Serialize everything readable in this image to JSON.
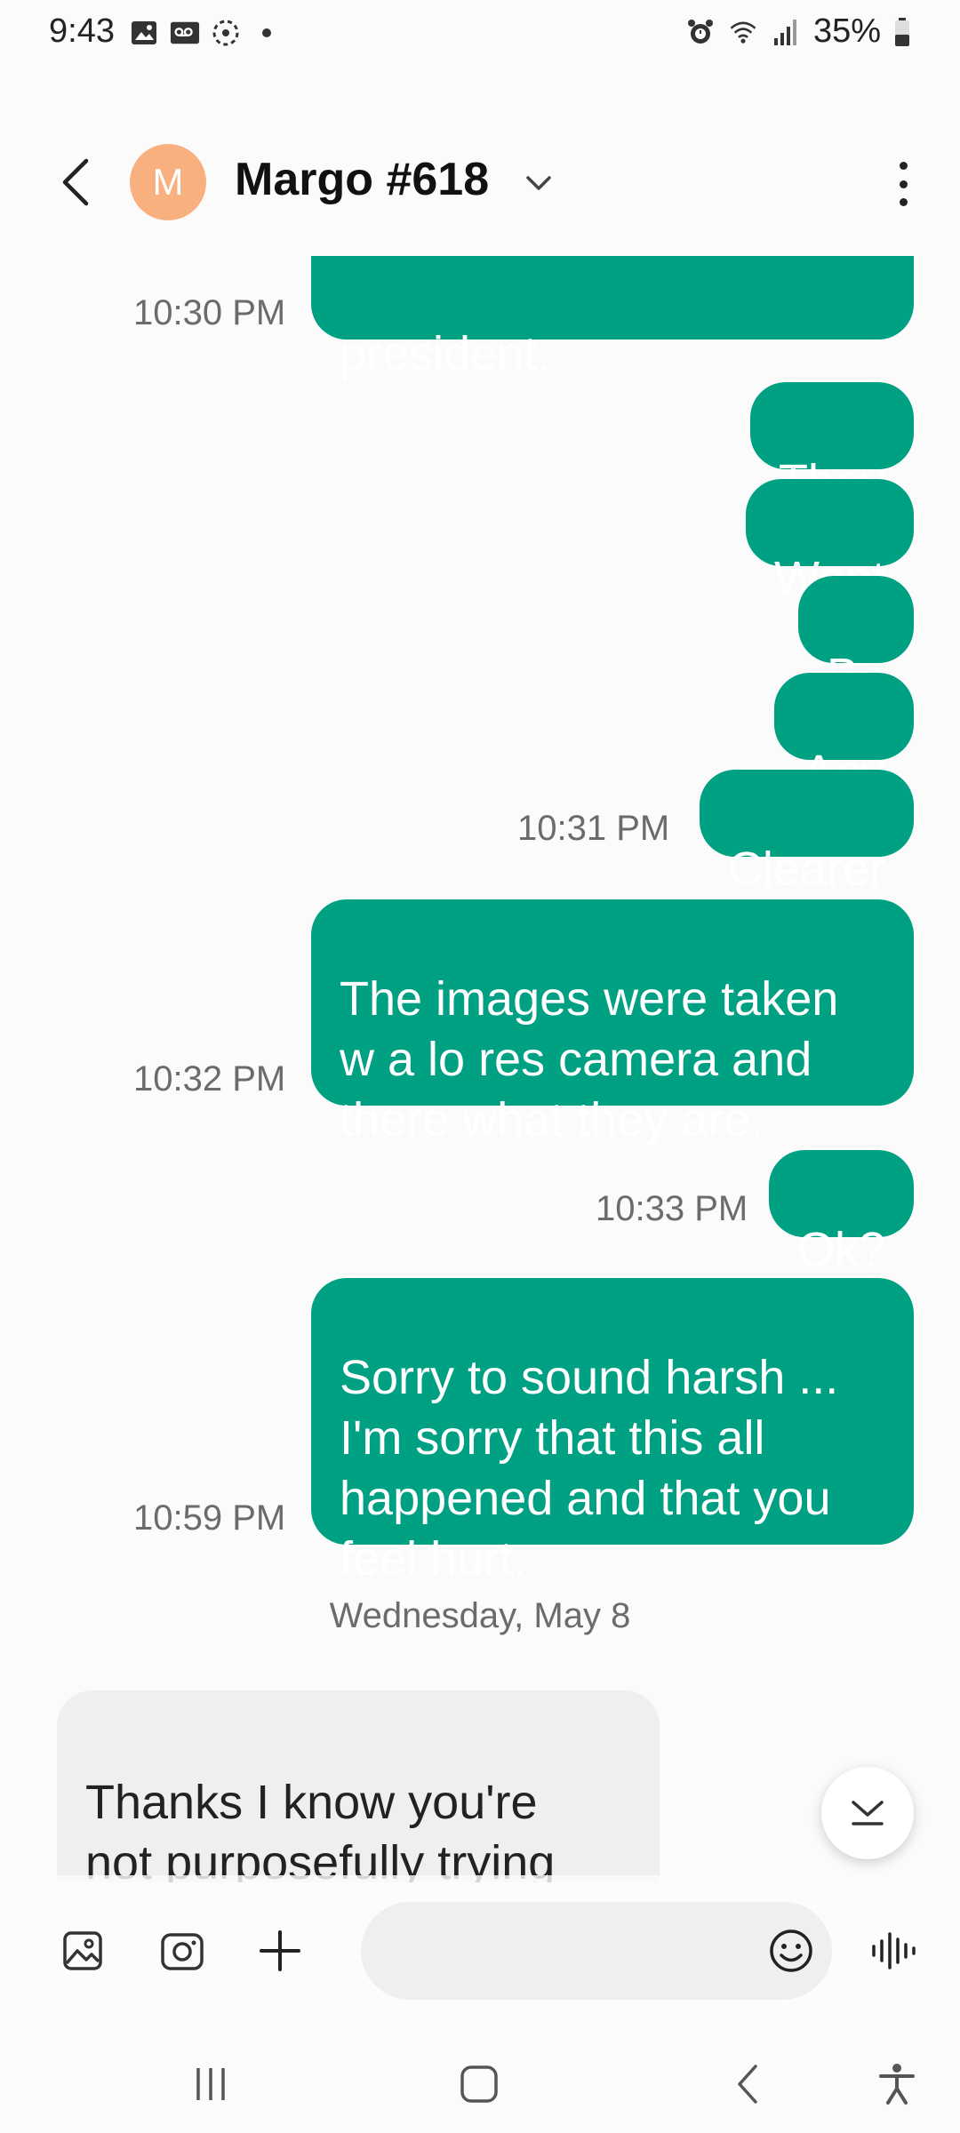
{
  "status_bar": {
    "time": "9:43",
    "battery": "35%",
    "left_icons": [
      "gallery-icon",
      "voicemail-icon",
      "sync-icon",
      "dot-icon"
    ],
    "right_icons": [
      "alarm-icon",
      "wifi-icon",
      "signal-icon",
      "battery-icon"
    ]
  },
  "header": {
    "avatar_initial": "M",
    "avatar_color": "#f9b07f",
    "contact_name": "Margo #618"
  },
  "messages": [
    {
      "text": "president.",
      "time": "10:30 PM"
    },
    {
      "text": "They"
    },
    {
      "text": "Wont"
    },
    {
      "text": "Be"
    },
    {
      "text": "Any"
    },
    {
      "text": "Clearer",
      "time": "10:31 PM"
    },
    {
      "text": "The images were taken\nw a lo res camera and\nthere what they are.",
      "time": "10:32 PM"
    },
    {
      "text": "Ok?",
      "time": "10:33 PM"
    },
    {
      "text": "Sorry to sound harsh ...\nI'm sorry that this all\nhappened and that you\nfeel hurt.",
      "time": "10:59 PM"
    }
  ],
  "date_separator": "Wednesday, May 8",
  "incoming_message": {
    "text": "Thanks I know you're\nnot purposefully trying\nto hurt me...I take heart\nin that! Truly\nI deciphered"
  },
  "composer": {
    "placeholder": "",
    "icons": [
      "gallery-icon",
      "camera-icon",
      "plus-icon",
      "emoji-icon",
      "voice-icon"
    ]
  },
  "colors": {
    "outgoing_bubble": "#00a083",
    "incoming_bubble": "#efefef",
    "background": "#fbfbfb"
  }
}
